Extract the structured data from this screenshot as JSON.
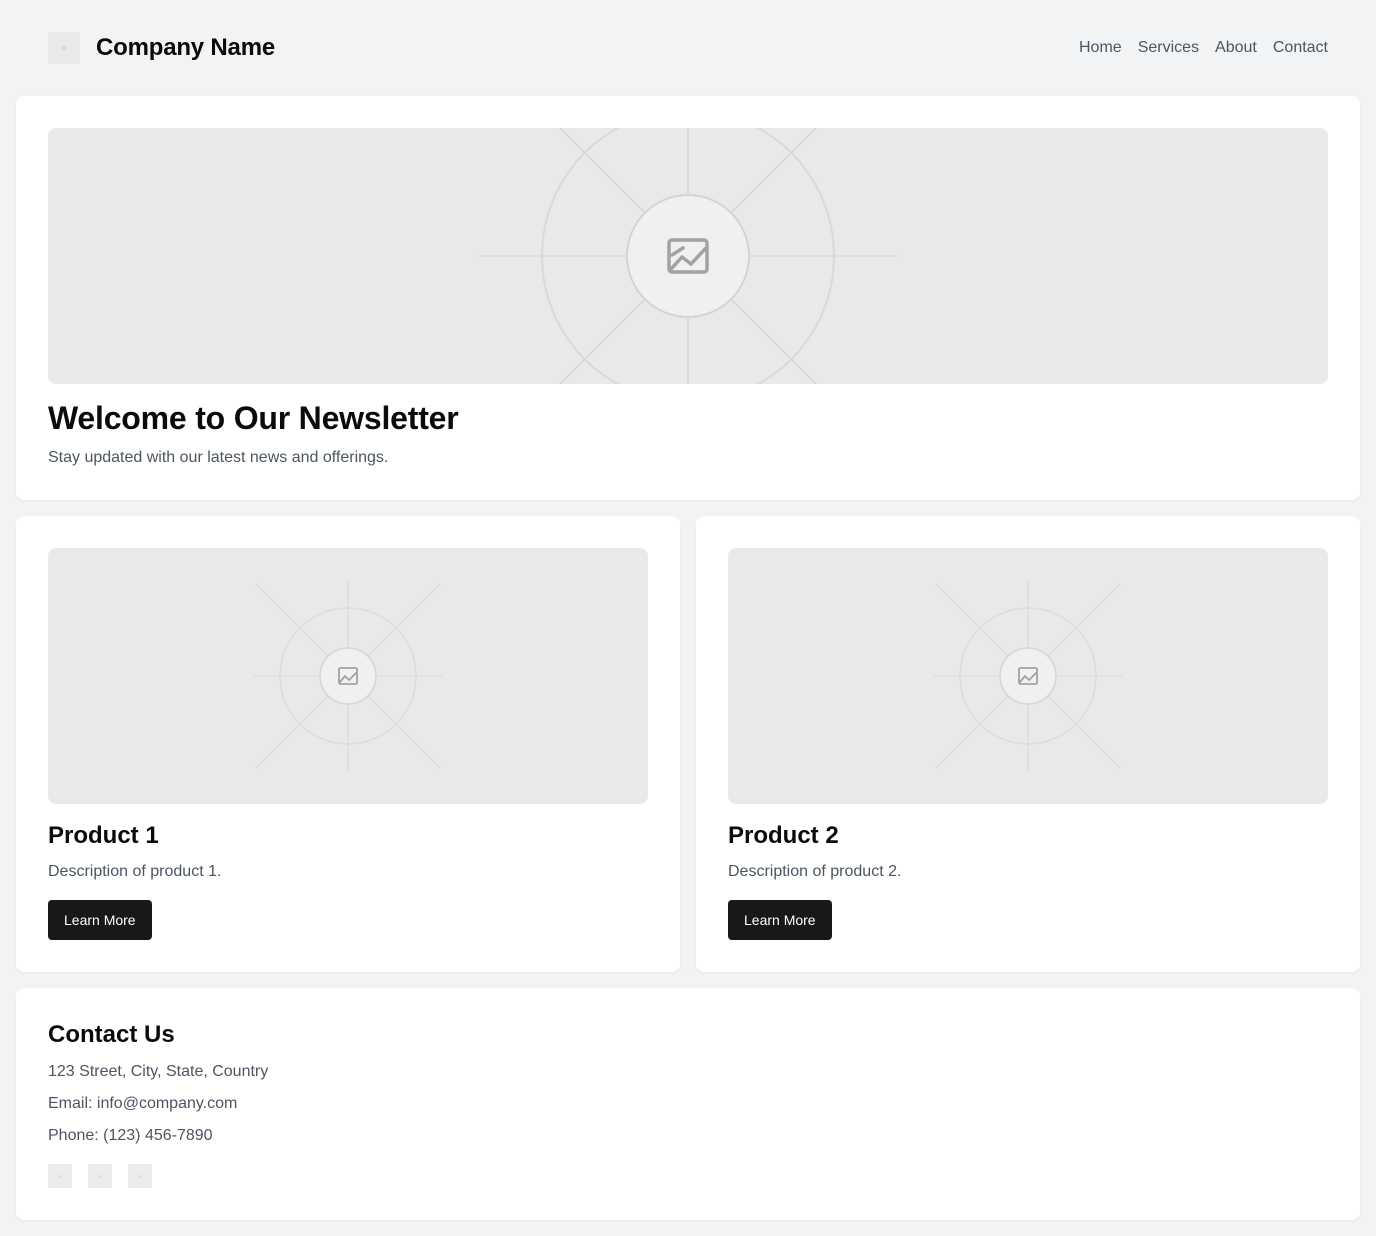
{
  "header": {
    "brand_name": "Company Name",
    "nav": [
      "Home",
      "Services",
      "About",
      "Contact"
    ]
  },
  "hero": {
    "title": "Welcome to Our Newsletter",
    "subtitle": "Stay updated with our latest news and offerings."
  },
  "products": [
    {
      "title": "Product 1",
      "description": "Description of product 1.",
      "button_label": "Learn More"
    },
    {
      "title": "Product 2",
      "description": "Description of product 2.",
      "button_label": "Learn More"
    }
  ],
  "contact": {
    "title": "Contact Us",
    "address": "123 Street, City, State, Country",
    "email": "Email: info@company.com",
    "phone": "Phone: (123) 456-7890"
  }
}
